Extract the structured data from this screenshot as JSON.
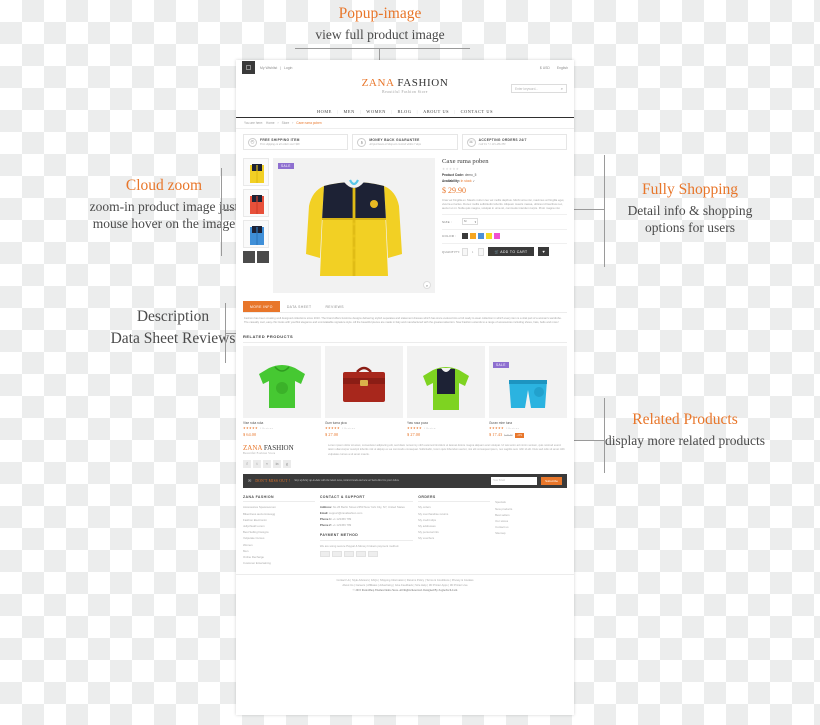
{
  "annotations": {
    "popup": {
      "title": "Popup-image",
      "sub": "view full product image"
    },
    "cloud": {
      "title": "Cloud zoom",
      "sub": "zoom-in product image just mouse hover on the image"
    },
    "fully": {
      "title": "Fully Shopping",
      "sub": "Detail info & shopping options for users"
    },
    "description": {
      "title": "Description",
      "sub": "Data Sheet Reviews"
    },
    "related": {
      "title": "Related Products",
      "sub": "display more related products"
    }
  },
  "site": {
    "topbar": {
      "my_wishlist": "My Wishlist",
      "login": "Login",
      "currency": "$ USD",
      "language": "English"
    },
    "brand": {
      "name_1": "ZANA",
      "name_2": "FASHION",
      "tagline": "Beautiful Fashion Store"
    },
    "search": {
      "placeholder": "Enter keyword..."
    },
    "nav": [
      "HOME",
      "MEN",
      "WOMEN",
      "BLOG",
      "ABOUT US",
      "CONTACT US"
    ],
    "breadcrumb": {
      "prefix": "You are here:",
      "home": "Home",
      "store": "Store",
      "current": "Caxe ruma poben"
    },
    "services": [
      {
        "title": "FREE SHIPPING ITEM",
        "sub": "Free shipping on all orders over $99",
        "icon": "truck-icon"
      },
      {
        "title": "MONEY BACK GUARANTEE",
        "sub": "All purchases at Shop are covered within 7 days",
        "icon": "money-icon"
      },
      {
        "title": "ACCEPTING ORDERS 24/7",
        "sub": "Call Us +1 123-456-789",
        "icon": "headset-icon"
      }
    ],
    "product": {
      "title": "Caxe ruma poben",
      "rating": "★★★★★",
      "code_label": "Product Code:",
      "code_value": "demo_5",
      "avail_label": "Availability:",
      "avail_value": "In stock",
      "price": "$ 29.90",
      "sale_badge": "SALE",
      "description": "Cras vel fringilla ex. Mauris rutrum leo vel mollis dapibus. Morbi urna nisi, maximus at fringilla eget, viverra et luctus. Donec mollis sollicitudin lobortis. Aliquam mauris massa, ultrices id faucibus nec, auctor ut mi. Nulla quis magna, volutpat in urna sit, commodo interdum turpis. Proin magna nisi.",
      "size_label": "SIZE :",
      "size_value": "M",
      "color_label": "COLOR :",
      "colors": [
        "#3a3a3a",
        "#f5a623",
        "#4a90d9",
        "#f5d922",
        "#f050d0"
      ],
      "qty_label": "QUANTITY:",
      "qty_value": "1",
      "add_to_cart": "ADD TO CART",
      "wishlist_icon": "heart-icon"
    },
    "tabs": [
      {
        "label": "MORE INFO",
        "active": true
      },
      {
        "label": "DATA SHEET",
        "active": false
      },
      {
        "label": "REVIEWS",
        "active": false
      }
    ],
    "tab_body": "Fashion has been creating well designed collections since 2010. The brand offers feminine designs delivering stylish separates and statement dresses which has since evolved into a full ready to wear collection in which every item is a vital part of a woman's wardrobe. The casually cool, easy chic looks with youthful elegance and unmistakable signature style. All the beautiful pieces are made in Italy and manufactured with the greatest attention. Now Fashion extends to a range of accessories including shoes, hats, belts and more!",
    "related_heading": "RELATED PRODUCTS",
    "related": [
      {
        "name": "Vise ruka ruka",
        "stars": "★★★★★",
        "reviews": "2 Reviews",
        "price": "$ 64.00",
        "old": "",
        "badge": "",
        "sale": false
      },
      {
        "name": "Gum tuma pica",
        "stars": "★★★★★",
        "reviews": "2 Reviews",
        "price": "$ 27.00",
        "old": "",
        "badge": "",
        "sale": false
      },
      {
        "name": "Yaw rusa poza",
        "stars": "★★★★★",
        "reviews": "1 Review",
        "price": "$ 27.00",
        "old": "",
        "badge": "",
        "sale": false
      },
      {
        "name": "Guran mire tuna",
        "stars": "★★★★★",
        "reviews": "3 Reviews",
        "price": "$ 17.43",
        "old": "$ 20.50",
        "badge": "-15%",
        "sale": true
      }
    ],
    "footer_brand": {
      "name_1": "ZANA",
      "name_2": "FASHION",
      "tagline": "Beautiful Fashion Store"
    },
    "footer_text": "Lorem ipsum dolor sit amet, consectetur adipiscing elit, sed diam nonummy nibh euismod tincidunt ut laoreet dolore magna aliquam erat volutpat. Ut wisi enim ad minim veniam, quis nostrud exerci tation ullamcorper suscipit lobortis nisl ut aliquip ex ea commodo consequat. Sollicitudin, lorem quis bibendum auctor, nisi elit consequat ipsum, nec sagittis sem nibh id elit. Duis sed odio sit amet nibh vulputate cursus a sit amet mauris.",
    "social_icons": [
      "facebook-icon",
      "twitter-icon",
      "rss-icon",
      "linkedin-icon",
      "google-plus-icon"
    ],
    "newsletter": {
      "heading": "DON'T MISS OUT !",
      "sub": "Stay stylishly up-to-date with the latest news, hottest trends and new arrivals direct to your inbox.",
      "placeholder": "Your Email",
      "button": "Subscribe"
    },
    "footer_columns": [
      {
        "title": "ZANA FASHION",
        "items": [
          "Accessoires Spacewomen",
          "Bikerdress auctormsiesgg",
          "Fashion Electronim",
          "Jellychuall Lorem",
          "Best Selling Designs",
          "Vulputate Cursus",
          "Women",
          "Men",
          "Online Recharge",
          "Customer Entertaining"
        ]
      },
      {
        "title": "CONTACT & SUPPORT",
        "items": []
      },
      {
        "title": "ORDERS",
        "items": [
          "My orders",
          "My merchandise returns",
          "My credit slips",
          "My addresses",
          "My personal info",
          "My vouchers"
        ]
      },
      {
        "title": "",
        "items": [
          "Specials",
          "New products",
          "Best sellers",
          "Our stores",
          "Contact us",
          "Sitemap"
        ]
      }
    ],
    "contact": {
      "address_label": "Address:",
      "address_value": "No 26 Berlin Street 2353 New York City, NY, United States",
      "email_label": "Email:",
      "email_value": "support@zanafashion.com",
      "phone1_label": "Phone 1:",
      "phone1_value": "+1 123456 789",
      "phone2_label": "Phone 2:",
      "phone2_value": "+1 123456 789"
    },
    "payment": {
      "title": "PAYMENT METHOD",
      "note": "We are using secure Paypal & Money brokers payment method.",
      "icons": [
        "discover-icon",
        "mastercard-icon",
        "paypal-icon",
        "visa-icon",
        "amex-icon"
      ]
    },
    "bottom_links_1": "Contact Us | Style Advisors | FAQs | Shipping Information | Returns Policy | Terms & Conditions | Privacy & Cookies",
    "bottom_links_2": "About Us | Careers | Affiliates | Advertising | Give Feedback | Size Help | 3D Printer Apps | 3D Printer Live",
    "copyright": "© 2015 PrestaShop Themes Demo Store. All Rights Reserved. Designed By ZognoTech.Com",
    "side_social": [
      "facebook-icon",
      "twitter-icon",
      "pinterest-icon"
    ]
  }
}
